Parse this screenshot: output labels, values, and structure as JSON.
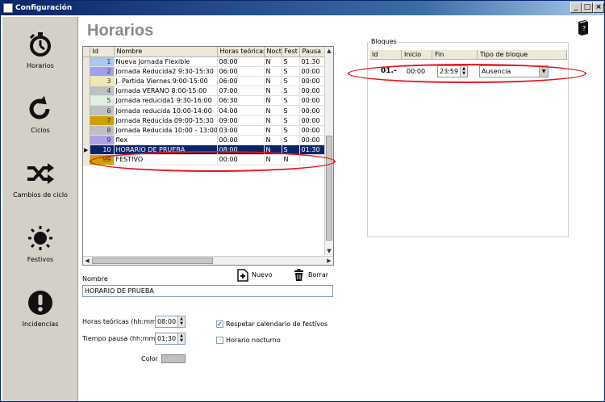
{
  "window": {
    "title": "Configuración"
  },
  "sidebar": {
    "items": [
      {
        "label": "Horarios",
        "icon": "stopwatch-icon"
      },
      {
        "label": "Ciclos",
        "icon": "refresh-icon"
      },
      {
        "label": "Cambios de ciclo",
        "icon": "shuffle-icon"
      },
      {
        "label": "Festivos",
        "icon": "sun-icon"
      },
      {
        "label": "Incidencias",
        "icon": "exclamation-icon"
      }
    ]
  },
  "main": {
    "title": "Horarios",
    "table": {
      "headers": [
        "Id",
        "Nombre",
        "Horas teóricas",
        "Noct",
        "Fest",
        "Pausa"
      ],
      "rows": [
        {
          "id": "1",
          "nombre": "Nueva Jornada Flexible",
          "horas": "08:00",
          "noct": "N",
          "fest": "S",
          "pausa": "01:30",
          "color": "#a8c8f0"
        },
        {
          "id": "2",
          "nombre": "Jornada Reducida2 9:30-15:30",
          "horas": "06:00",
          "noct": "N",
          "fest": "S",
          "pausa": "00:00",
          "color": "#a0a0f0"
        },
        {
          "id": "3",
          "nombre": "J. Partida Viernes 9:00-15:00",
          "horas": "06:00",
          "noct": "N",
          "fest": "S",
          "pausa": "00:00",
          "color": "#f0e8b0"
        },
        {
          "id": "4",
          "nombre": "Jornada VERANO 8:00-15:00",
          "horas": "07:00",
          "noct": "N",
          "fest": "S",
          "pausa": "00:00",
          "color": "#c0c0c0"
        },
        {
          "id": "5",
          "nombre": "Jornada reducida1 9:30-16:00",
          "horas": "06:30",
          "noct": "N",
          "fest": "S",
          "pausa": "00:00",
          "color": "#e0f0e0"
        },
        {
          "id": "6",
          "nombre": "Jornada reducida 10:00-14:00",
          "horas": "04:00",
          "noct": "N",
          "fest": "S",
          "pausa": "00:00",
          "color": "#c0c0c0"
        },
        {
          "id": "7",
          "nombre": "Jornada Reducida 09:00-15:30",
          "horas": "09:00",
          "noct": "N",
          "fest": "S",
          "pausa": "00:00",
          "color": "#d0a000"
        },
        {
          "id": "8",
          "nombre": "Jornada Reducida 10:00 - 13:00",
          "horas": "03:00",
          "noct": "N",
          "fest": "S",
          "pausa": "00:00",
          "color": "#c0c0c0"
        },
        {
          "id": "9",
          "nombre": "flex",
          "horas": "00:00",
          "noct": "N",
          "fest": "S",
          "pausa": "00:00",
          "color": "#b0a0e8"
        },
        {
          "id": "10",
          "nombre": "HORARIO DE PRUEBA",
          "horas": "08:00",
          "noct": "N",
          "fest": "S",
          "pausa": "01:30",
          "color": "#d0d0d0",
          "selected": true
        },
        {
          "id": "99",
          "nombre": "FESTIVO",
          "horas": "00:00",
          "noct": "N",
          "fest": "N",
          "pausa": "",
          "color": "#d0a000"
        }
      ]
    },
    "buttons": {
      "nuevo": "Nuevo",
      "borrar": "Borrar"
    },
    "form": {
      "nombre_label": "Nombre",
      "nombre_value": "HORARIO DE PRUEBA",
      "horas_label": "Horas teóricas (hh:mm)",
      "horas_value": "08:00",
      "pausa_label": "Tiempo pausa (hh:mm)",
      "pausa_value": "01:30",
      "color_label": "Color",
      "respetar_label": "Respetar calendario de festivos",
      "respetar_checked": "✓",
      "nocturno_label": "Horario nocturno"
    },
    "bloques": {
      "legend": "Bloques",
      "headers": [
        "Id",
        "Inicio",
        "Fin",
        "Tipo de bloque"
      ],
      "row": {
        "id": "01.-",
        "inicio": "00:00",
        "fin": "23:59",
        "tipo": "Ausencia"
      }
    }
  }
}
